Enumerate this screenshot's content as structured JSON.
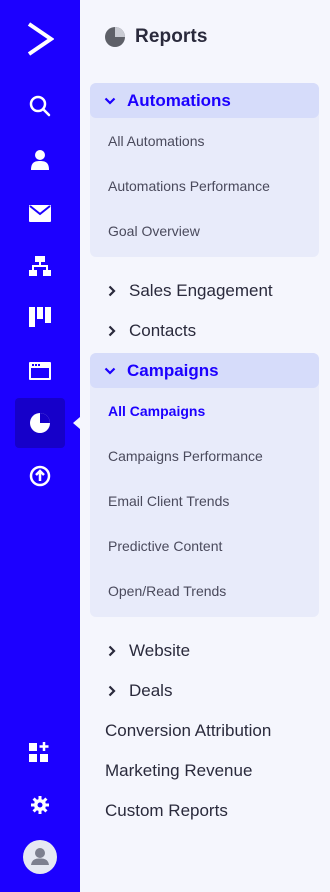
{
  "nav": {
    "items": [
      {
        "icon": "logo-arrow-icon"
      },
      {
        "icon": "search-icon"
      },
      {
        "icon": "contacts-person-icon"
      },
      {
        "icon": "email-envelope-icon"
      },
      {
        "icon": "automation-flow-icon"
      },
      {
        "icon": "deals-board-icon"
      },
      {
        "icon": "website-icon"
      },
      {
        "icon": "reports-pie-icon",
        "active": true
      },
      {
        "icon": "upgrade-arrow-up-icon"
      },
      {
        "icon": "apps-add-icon"
      },
      {
        "icon": "settings-gear-icon"
      },
      {
        "icon": "user-avatar-icon"
      }
    ],
    "accent_color": "#1c00ff"
  },
  "panel": {
    "title": "Reports",
    "automations": {
      "label": "Automations",
      "expanded": true,
      "items": [
        "All Automations",
        "Automations Performance",
        "Goal Overview"
      ]
    },
    "sales_engagement": {
      "label": "Sales Engagement",
      "expanded": false
    },
    "contacts": {
      "label": "Contacts",
      "expanded": false
    },
    "campaigns": {
      "label": "Campaigns",
      "expanded": true,
      "items": [
        "All Campaigns",
        "Campaigns Performance",
        "Email Client Trends",
        "Predictive Content",
        "Open/Read Trends"
      ],
      "active_item": "All Campaigns"
    },
    "website": {
      "label": "Website",
      "expanded": false
    },
    "deals": {
      "label": "Deals",
      "expanded": false
    },
    "links": [
      "Conversion Attribution",
      "Marketing Revenue",
      "Custom Reports"
    ]
  }
}
